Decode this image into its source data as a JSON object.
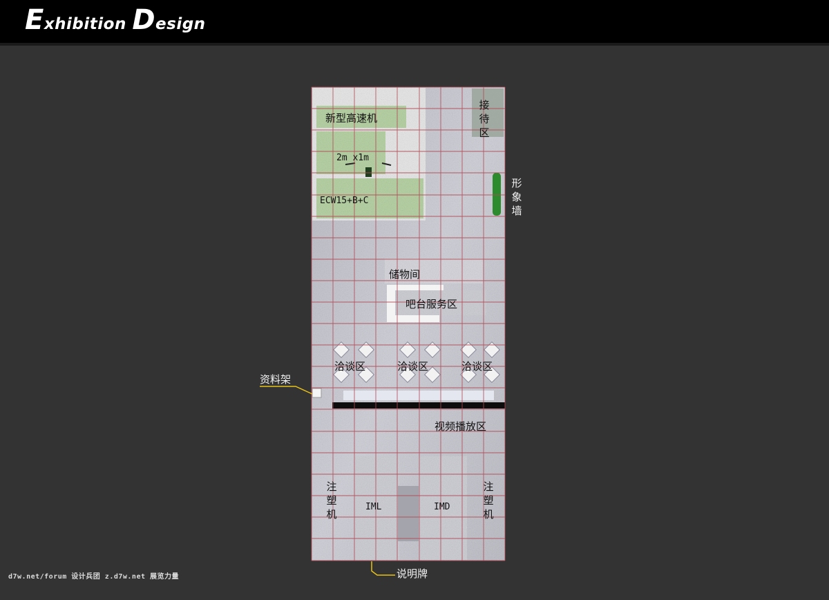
{
  "header": {
    "title_cap1": "E",
    "title_rest1": "xhibition",
    "title_cap2": "D",
    "title_rest2": "esign"
  },
  "zones": {
    "machine_new": "新型高速机",
    "size_note": "2m x1m",
    "machine_model": "ECW15+B+C",
    "reception": "接待区",
    "image_wall": "形象墙",
    "storage": "储物间",
    "bar_service": "吧台服务区",
    "meeting_1": "洽谈区",
    "meeting_2": "洽谈区",
    "meeting_3": "洽谈区",
    "brochure_rack": "资料架",
    "video_area": "视频播放区",
    "injection_left": "注塑机",
    "injection_right": "注塑机",
    "iml": "IML",
    "imd": "IMD",
    "sign_board": "说明牌"
  },
  "footer": {
    "credit": "d7w.net/forum 设计兵团 z.d7w.net 展览力量"
  },
  "colors": {
    "background": "#333333",
    "header": "#000000",
    "grid_line": "#b04a55",
    "floor": "#c4c4cc",
    "machine_fill": "#b8d3a6",
    "callout": "#e8c21a",
    "hedge": "#2d8a2d"
  }
}
